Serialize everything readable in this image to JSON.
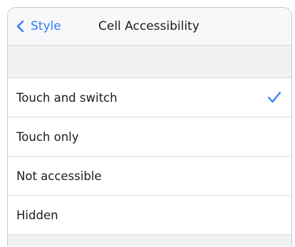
{
  "navbar": {
    "back_label": "Style",
    "title": "Cell Accessibility"
  },
  "options": [
    {
      "label": "Touch and switch",
      "selected": true
    },
    {
      "label": "Touch only",
      "selected": false
    },
    {
      "label": "Not accessible",
      "selected": false
    },
    {
      "label": "Hidden",
      "selected": false
    }
  ],
  "colors": {
    "accent": "#2f7cf6",
    "navbar_bg": "#f8f8fa",
    "group_bg": "#f1f1f4",
    "separator": "#dcdce0"
  },
  "icons": {
    "back": "chevron-left-icon",
    "selected": "checkmark-icon"
  }
}
